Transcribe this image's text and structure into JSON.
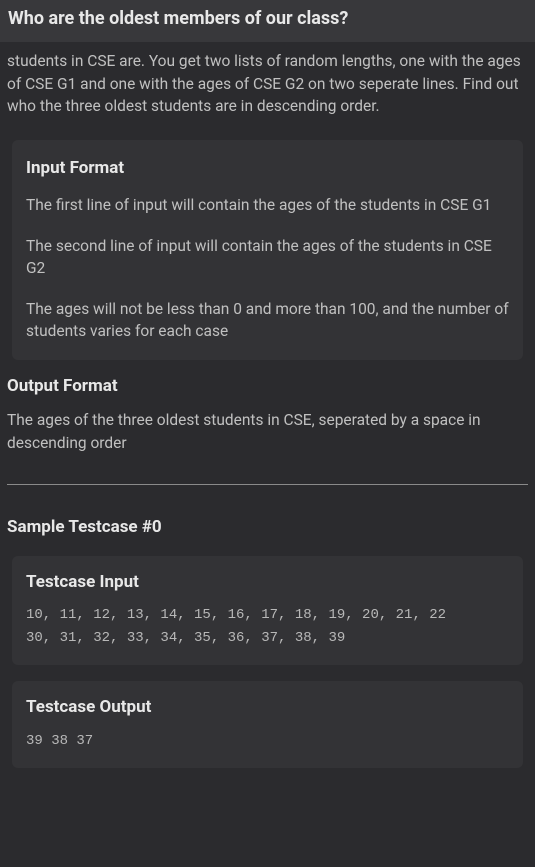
{
  "title": "Who are the oldest members of our class?",
  "intro": "students in CSE are. You get two lists of random lengths, one with the ages of CSE G1 and one with the ages of CSE G2 on two seperate lines. Find out who the three oldest students are in descending order.",
  "input_format": {
    "heading": "Input Format",
    "p1": "The first line of input will contain the ages of the students in CSE G1",
    "p2": "The second line of input will contain the ages of the students in CSE G2",
    "p3": "The ages will not be less than 0 and more than 100, and the number of students varies for each case"
  },
  "output_format": {
    "heading": "Output Format",
    "desc": "The ages of the three oldest students in CSE, seperated by a space in descending order"
  },
  "sample": {
    "title": "Sample Testcase #0",
    "input_heading": "Testcase Input",
    "input_text": "10, 11, 12, 13, 14, 15, 16, 17, 18, 19, 20, 21, 22\n30, 31, 32, 33, 34, 35, 36, 37, 38, 39",
    "output_heading": "Testcase Output",
    "output_text": "39 38 37"
  }
}
